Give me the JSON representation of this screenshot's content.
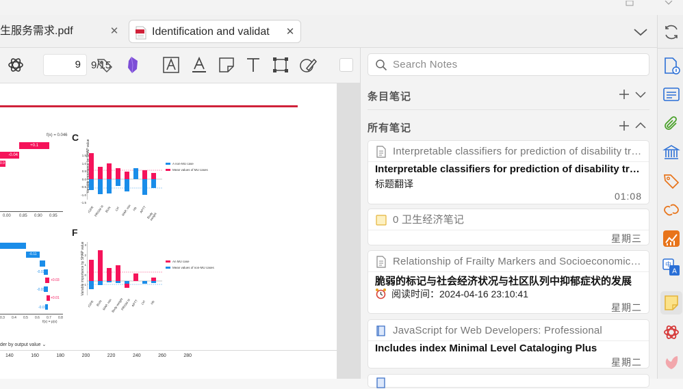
{
  "tabs": [
    {
      "label": "生服务需求.pdf",
      "active": false
    },
    {
      "label": "Identification and validat",
      "active": true
    }
  ],
  "toolbar": {
    "current_page": "9",
    "total_pages": "9/15"
  },
  "figure": {
    "panel_c_label": "C",
    "panel_f_label": "F",
    "top_value": "f(x) = 0.046",
    "c_legend": [
      "A non-MU case",
      "Mean values of MU cases"
    ],
    "f_legend": [
      "An MU case",
      "Mean values of non-MU cases"
    ],
    "c_ylabel": "Variable importance by SHAP value",
    "f_ylabel": "Variable importance by SHAP value",
    "c_ticks": [
      "1.5",
      "1.0",
      "0.5",
      "0.0",
      "-0.5",
      "-1.0",
      "-1.5"
    ],
    "f_ticks": [
      "3",
      "2",
      "1",
      "0",
      "-1"
    ],
    "c_xcats": [
      "rGFR",
      "PRISM III",
      "BUN",
      "LVI",
      "MAP, min",
      "Hb",
      "APTT",
      "Body weight"
    ],
    "f_xcats": [
      "rGFR",
      "BUN",
      "MAP, min",
      "Body weight",
      "PRISM III",
      "APTT",
      "LVI",
      "Hb"
    ],
    "left_wf_top": [
      "+0.1",
      "-0.04",
      "0.9"
    ],
    "left_wf_bottom": [
      "-0.11",
      "-0.03",
      "+0.03",
      "-0.03",
      "+0.01",
      "-0.01"
    ],
    "left_axis_top": [
      "0.00",
      "0.85",
      "0.90",
      "0.95"
    ],
    "left_axis_bottom": [
      "0.3",
      "0.4",
      "0.5",
      "0.6",
      "0.7",
      "0.8"
    ],
    "left_bottom_label": "f(x) = p(x)",
    "order_label": "der by output value",
    "bottom_axis": [
      "140",
      "160",
      "180",
      "200",
      "220",
      "240",
      "260",
      "280"
    ]
  },
  "notes": {
    "search_placeholder": "Search Notes",
    "item_notes_title": "条目笔记",
    "all_notes_title": "所有笔记",
    "cards": [
      {
        "header": "Interpretable classifiers for prediction of disability trajectories",
        "title": "Interpretable classifiers for prediction of disability trajectories",
        "body": "标题翻译",
        "time": "01:08"
      },
      {
        "header": "0 卫生经济笔记",
        "title": "",
        "body": "",
        "time": "星期三"
      },
      {
        "header": "Relationship of Frailty Markers and Socioeconomic Status",
        "title": "脆弱的标记与社会经济状况与社区队列中抑郁症状的发展",
        "body": "阅读时间：2024-04-16 23:10:41",
        "time": "星期二"
      },
      {
        "header": "JavaScript for Web Developers: Professional",
        "title": "Includes index Minimal Level Cataloging Plus",
        "body": "",
        "time": "星期二"
      }
    ]
  },
  "colors": {
    "accent_red": "#d0223a",
    "bar_red": "#f5135a",
    "bar_blue": "#1a8de9",
    "icon_orange": "#e8741a",
    "icon_blue": "#2a6fd6",
    "icon_green": "#4aa12a"
  }
}
